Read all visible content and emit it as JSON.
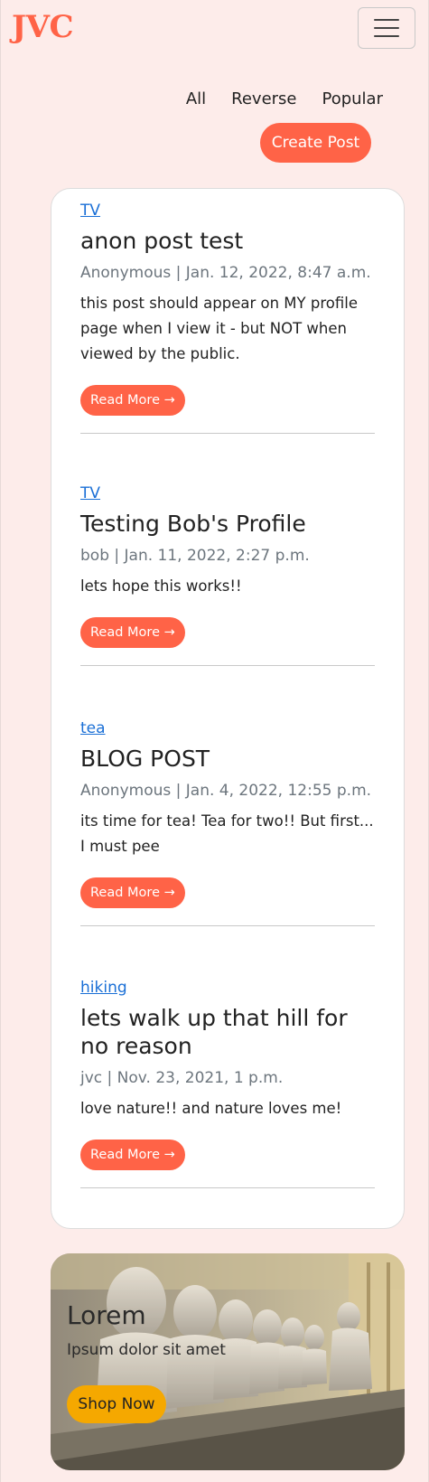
{
  "header": {
    "brand": "JVC",
    "menu_icon": "hamburger-icon"
  },
  "filters": {
    "all": "All",
    "reverse": "Reverse",
    "popular": "Popular"
  },
  "create_post_label": "Create Post",
  "posts": [
    {
      "category": "TV",
      "title": "anon post test",
      "meta": "Anonymous | Jan. 12, 2022, 8:47 a.m.",
      "excerpt": "this post should appear on MY profile page when I view it - but NOT when viewed by the public.",
      "read_more": "Read More →"
    },
    {
      "category": "TV",
      "title": "Testing Bob's Profile",
      "meta": "bob | Jan. 11, 2022, 2:27 p.m.",
      "excerpt": "lets hope this works!!",
      "read_more": "Read More →"
    },
    {
      "category": "tea",
      "title": "BLOG POST",
      "meta": "Anonymous | Jan. 4, 2022, 12:55 p.m.",
      "excerpt": "its time for tea! Tea for two!! But first... I must pee",
      "read_more": "Read More →"
    },
    {
      "category": "hiking",
      "title": "lets walk up that hill for no reason",
      "meta": "jvc | Nov. 23, 2021, 1 p.m.",
      "excerpt": "love nature!! and nature loves me!",
      "read_more": "Read More →"
    }
  ],
  "promo": {
    "title": "Lorem",
    "subtitle": "Ipsum dolor sit amet",
    "button": "Shop Now"
  },
  "colors": {
    "background": "#fdecea",
    "accent": "#ff6347",
    "link": "#1a6fd6",
    "meta": "#6c757d",
    "promo_button": "#f5a800"
  }
}
